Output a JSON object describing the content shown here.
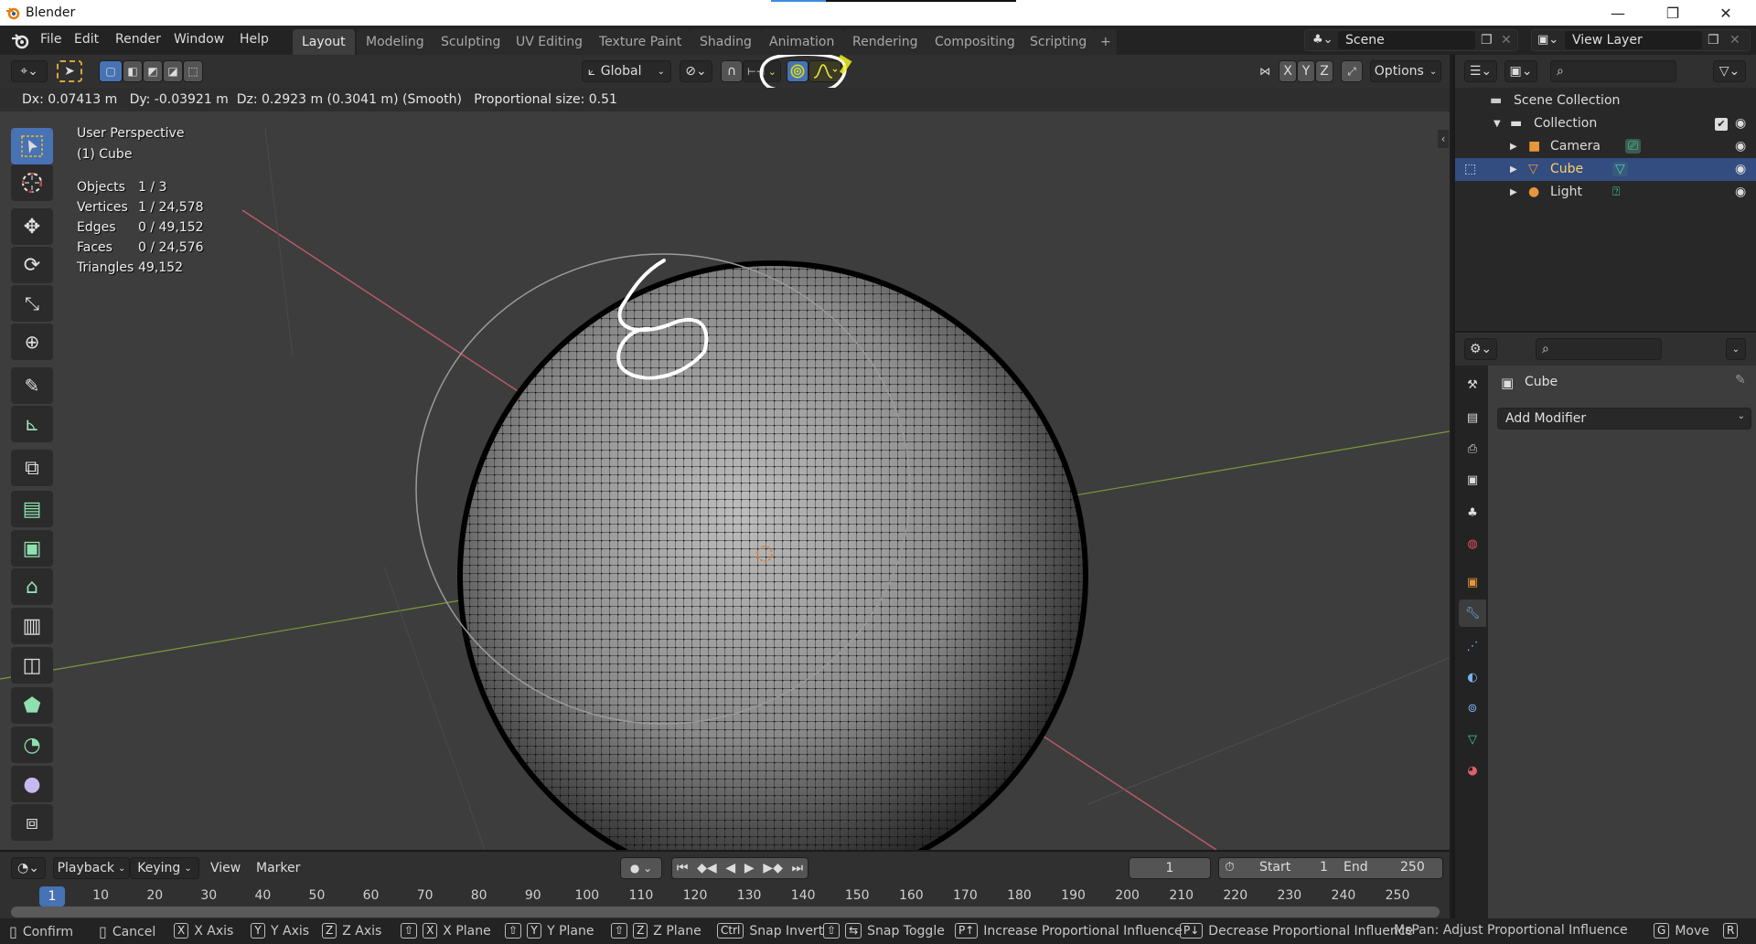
{
  "window": {
    "title": "Blender",
    "controls": {
      "minimize": "—",
      "maximize": "❐",
      "close": "✕"
    }
  },
  "menu": [
    "File",
    "Edit",
    "Render",
    "Window",
    "Help"
  ],
  "workspaces": {
    "tabs": [
      "Layout",
      "Modeling",
      "Sculpting",
      "UV Editing",
      "Texture Paint",
      "Shading",
      "Animation",
      "Rendering",
      "Compositing",
      "Scripting"
    ],
    "active": "Layout",
    "add_label": "+"
  },
  "scene": {
    "label": "Scene",
    "view_layer": "View Layer"
  },
  "viewport_header": {
    "orientation": "Global",
    "axes": [
      "X",
      "Y",
      "Z"
    ],
    "options_label": "Options",
    "proportional_editing_enabled": true,
    "proportional_falloff": "smooth-falloff-icon"
  },
  "operator_info": "Dx: 0.07413 m   Dy: -0.03921 m  Dz: 0.2923 m (0.3041 m) (Smooth)   Proportional size: 0.51",
  "viewport": {
    "view_name": "User Perspective",
    "object_name": "(1) Cube",
    "stats": [
      {
        "label": "Objects",
        "value": "1 / 3"
      },
      {
        "label": "Vertices",
        "value": "1 / 24,578"
      },
      {
        "label": "Edges",
        "value": "0 / 49,152"
      },
      {
        "label": "Faces",
        "value": "0 / 24,576"
      },
      {
        "label": "Triangles",
        "value": "49,152"
      }
    ],
    "axis_colors": {
      "x": "#c45a6a",
      "y": "#7a9a3a"
    }
  },
  "toolbar": [
    "select-box",
    "cursor",
    "move",
    "rotate",
    "scale",
    "transform",
    "annotate",
    "measure",
    "add-cube",
    "extrude",
    "inset",
    "bevel",
    "loop-cut",
    "knife",
    "poly-build",
    "spin",
    "smooth",
    "shrink-fatten"
  ],
  "outliner": {
    "root": "Scene Collection",
    "items": [
      {
        "name": "Collection",
        "level": 0,
        "selected": false
      },
      {
        "name": "Camera",
        "level": 1,
        "selected": false
      },
      {
        "name": "Cube",
        "level": 1,
        "selected": true
      },
      {
        "name": "Light",
        "level": 1,
        "selected": false
      }
    ]
  },
  "properties": {
    "object_name": "Cube",
    "add_modifier_label": "Add Modifier",
    "active_tab": "modifiers"
  },
  "timeline": {
    "menus": [
      "Playback",
      "Keying",
      "View",
      "Marker"
    ],
    "current_frame": "1",
    "start_label": "Start",
    "start": "1",
    "end_label": "End",
    "end": "250",
    "ticks": [
      "10",
      "20",
      "30",
      "40",
      "50",
      "60",
      "70",
      "80",
      "90",
      "100",
      "110",
      "120",
      "130",
      "140",
      "150",
      "160",
      "170",
      "180",
      "190",
      "200",
      "210",
      "220",
      "230",
      "240",
      "250"
    ]
  },
  "statusbar": [
    {
      "keys": [
        "mouse-left"
      ],
      "label": "Confirm"
    },
    {
      "keys": [
        "mouse-right"
      ],
      "label": "Cancel"
    },
    {
      "keys": [
        "X"
      ],
      "label": "X Axis"
    },
    {
      "keys": [
        "Y"
      ],
      "label": "Y Axis"
    },
    {
      "keys": [
        "Z"
      ],
      "label": "Z Axis"
    },
    {
      "keys": [
        "⇧",
        "X"
      ],
      "label": "X Plane"
    },
    {
      "keys": [
        "⇧",
        "Y"
      ],
      "label": "Y Plane"
    },
    {
      "keys": [
        "⇧",
        "Z"
      ],
      "label": "Z Plane"
    },
    {
      "keys": [
        "Ctrl"
      ],
      "label": "Snap Invert"
    },
    {
      "keys": [
        "⇧",
        "⇆"
      ],
      "label": "Snap Toggle"
    },
    {
      "keys": [
        "P↑"
      ],
      "label": "Increase Proportional Influence"
    },
    {
      "keys": [
        "P↓"
      ],
      "label": "Decrease Proportional Influence"
    },
    {
      "keys": [],
      "label": "MsPan: Adjust Proportional Influence"
    },
    {
      "keys": [
        "G"
      ],
      "label": "Move"
    },
    {
      "keys": [
        "R"
      ],
      "label": "R"
    }
  ]
}
